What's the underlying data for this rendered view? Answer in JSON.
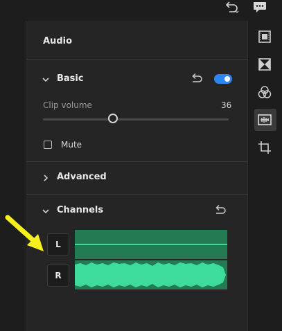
{
  "topbar": {
    "undo_icon": "undo-icon",
    "comments_icon": "speech-bubble-icon"
  },
  "panel": {
    "title": "Audio",
    "basic": {
      "label": "Basic",
      "enabled": true,
      "reset_icon": "undo-icon"
    },
    "clip_volume": {
      "label": "Clip volume",
      "value": "36"
    },
    "mute": {
      "label": "Mute",
      "checked": false
    },
    "advanced": {
      "label": "Advanced"
    },
    "channels": {
      "label": "Channels",
      "reset_icon": "undo-icon",
      "items": [
        {
          "label": "L",
          "waveform": "flat"
        },
        {
          "label": "R",
          "waveform": "full"
        }
      ]
    }
  },
  "rail": {
    "items": [
      {
        "icon": "film-frame-icon"
      },
      {
        "icon": "transition-icon"
      },
      {
        "icon": "color-circles-icon"
      },
      {
        "icon": "audio-waveform-icon",
        "active": true
      },
      {
        "icon": "crop-icon"
      }
    ]
  },
  "annotation": {
    "type": "arrow",
    "color": "#f5f01e"
  },
  "colors": {
    "accent": "#2d86f0",
    "waveform_bg": "#247a52",
    "waveform": "#3ddc9a",
    "annotation": "#f5f01e"
  }
}
